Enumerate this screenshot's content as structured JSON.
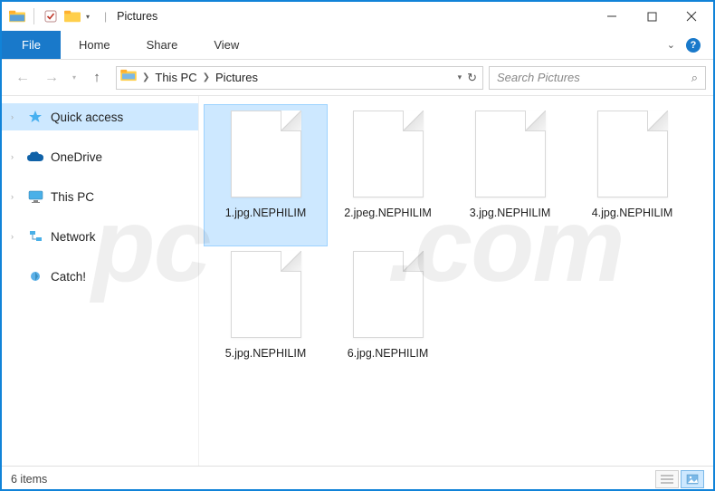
{
  "titlebar": {
    "title": "Pictures",
    "divider": "|"
  },
  "ribbon": {
    "file": "File",
    "tabs": [
      "Home",
      "Share",
      "View"
    ]
  },
  "breadcrumb": {
    "root": "This PC",
    "folder": "Pictures"
  },
  "search": {
    "placeholder": "Search Pictures"
  },
  "sidebar": {
    "items": [
      {
        "label": "Quick access"
      },
      {
        "label": "OneDrive"
      },
      {
        "label": "This PC"
      },
      {
        "label": "Network"
      },
      {
        "label": "Catch!"
      }
    ]
  },
  "files": [
    {
      "name": "1.jpg.NEPHILIM"
    },
    {
      "name": "2.jpeg.NEPHILIM"
    },
    {
      "name": "3.jpg.NEPHILIM"
    },
    {
      "name": "4.jpg.NEPHILIM"
    },
    {
      "name": "5.jpg.NEPHILIM"
    },
    {
      "name": "6.jpg.NEPHILIM"
    }
  ],
  "statusbar": {
    "count": "6 items"
  }
}
